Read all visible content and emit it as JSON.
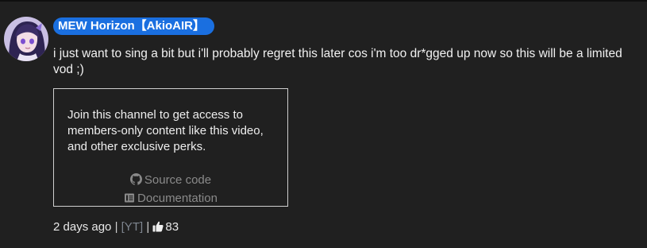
{
  "comment": {
    "author": "MEW Horizon【AkioAIR】",
    "text": "i just want to sing a bit but i'll probably regret this later cos i'm too dr*gged up now so this will be a limited vod ;)",
    "avatar_icon": "anime-avatar",
    "badge_color": "#1a6fe0"
  },
  "members_box": {
    "message": "Join this channel to get access to members-only content like this video, and other exclusive perks.",
    "source_code_label": "Source code",
    "source_code_icon": "github-icon",
    "documentation_label": "Documentation",
    "documentation_icon": "book-icon"
  },
  "footer": {
    "time_ago": "2 days ago",
    "separator": "|",
    "yt_tag": "[YT]",
    "like_icon": "thumbs-up-icon",
    "like_count": "83"
  }
}
